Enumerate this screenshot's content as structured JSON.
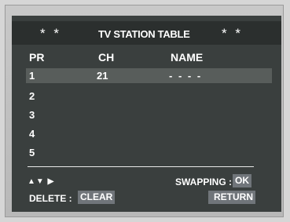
{
  "header": {
    "star_left": "* *",
    "title": "TV STATION TABLE",
    "star_right": "* *"
  },
  "columns": {
    "pr": "PR",
    "ch": "CH",
    "name": "NAME"
  },
  "rows": [
    {
      "pr": "1",
      "ch": "21",
      "name": "- - - -"
    },
    {
      "pr": "2",
      "ch": "",
      "name": ""
    },
    {
      "pr": "3",
      "ch": "",
      "name": ""
    },
    {
      "pr": "4",
      "ch": "",
      "name": ""
    },
    {
      "pr": "5",
      "ch": "",
      "name": ""
    }
  ],
  "footer": {
    "nav_glyphs": "▲▼ ▶",
    "swapping_label": "SWAPPING :",
    "swapping_key": "OK",
    "delete_label": "DELETE  :",
    "delete_key": "CLEAR",
    "return_key": "RETURN"
  }
}
